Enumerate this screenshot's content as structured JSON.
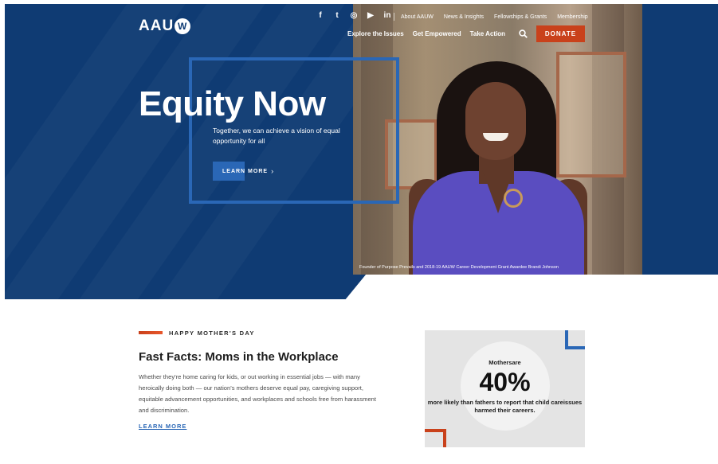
{
  "brand": {
    "logo_text": "AAU",
    "logo_mark": "W"
  },
  "social": [
    {
      "icon": "facebook-icon",
      "glyph": "f"
    },
    {
      "icon": "twitter-icon",
      "glyph": "t"
    },
    {
      "icon": "instagram-icon",
      "glyph": "◎"
    },
    {
      "icon": "youtube-icon",
      "glyph": "▶"
    },
    {
      "icon": "linkedin-icon",
      "glyph": "in"
    }
  ],
  "utility_nav": [
    "About AAUW",
    "News & Insights",
    "Fellowships & Grants",
    "Membership"
  ],
  "main_nav": [
    "Explore the Issues",
    "Get Empowered",
    "Take Action"
  ],
  "donate_label": "DONATE",
  "hero": {
    "headline": "Equity Now",
    "subtext": "Together, we can achieve a vision of equal opportunity for all",
    "button_label": "LEARN MORE",
    "caption": "Founder of Purpose Prevails and 2018-19 AAUW Career Development Grant Awardee Brandi Johnson"
  },
  "feature": {
    "eyebrow": "HAPPY MOTHER'S DAY",
    "title": "Fast Facts: Moms in the Workplace",
    "body": "Whether they're home caring for kids, or out working in essential jobs — with many heroically doing both — our nation's mothers deserve equal pay, caregiving support, equitable advancement opportunities, and workplaces and schools free from harassment and discrimination.",
    "link_label": "LEARN MORE"
  },
  "stat": {
    "pre": "Mothersare",
    "value": "40%",
    "post": "more likely than fathers to report that child careissues harmed their careers."
  },
  "colors": {
    "navy": "#0f3b73",
    "accent_blue": "#2a67b6",
    "accent_orange": "#c9411b"
  }
}
